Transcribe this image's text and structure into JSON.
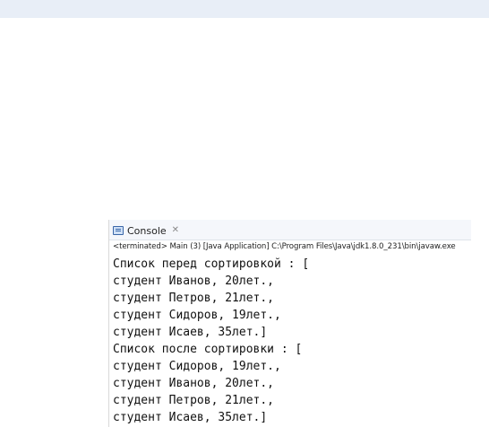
{
  "console": {
    "tab_label": "Console",
    "tab_close": "✕",
    "status": "<terminated> Main (3) [Java Application] C:\\Program Files\\Java\\jdk1.8.0_231\\bin\\javaw.exe",
    "lines": [
      "Список перед сортировкой : [",
      "студент Иванов, 20лет.,",
      "студент Петров, 21лет.,",
      "студент Сидоров, 19лет.,",
      "студент Исаев, 35лет.]",
      "Список после сортировки : [",
      "студент Сидоров, 19лет.,",
      "студент Иванов, 20лет.,",
      "студент Петров, 21лет.,",
      "студент Исаев, 35лет.]"
    ]
  }
}
